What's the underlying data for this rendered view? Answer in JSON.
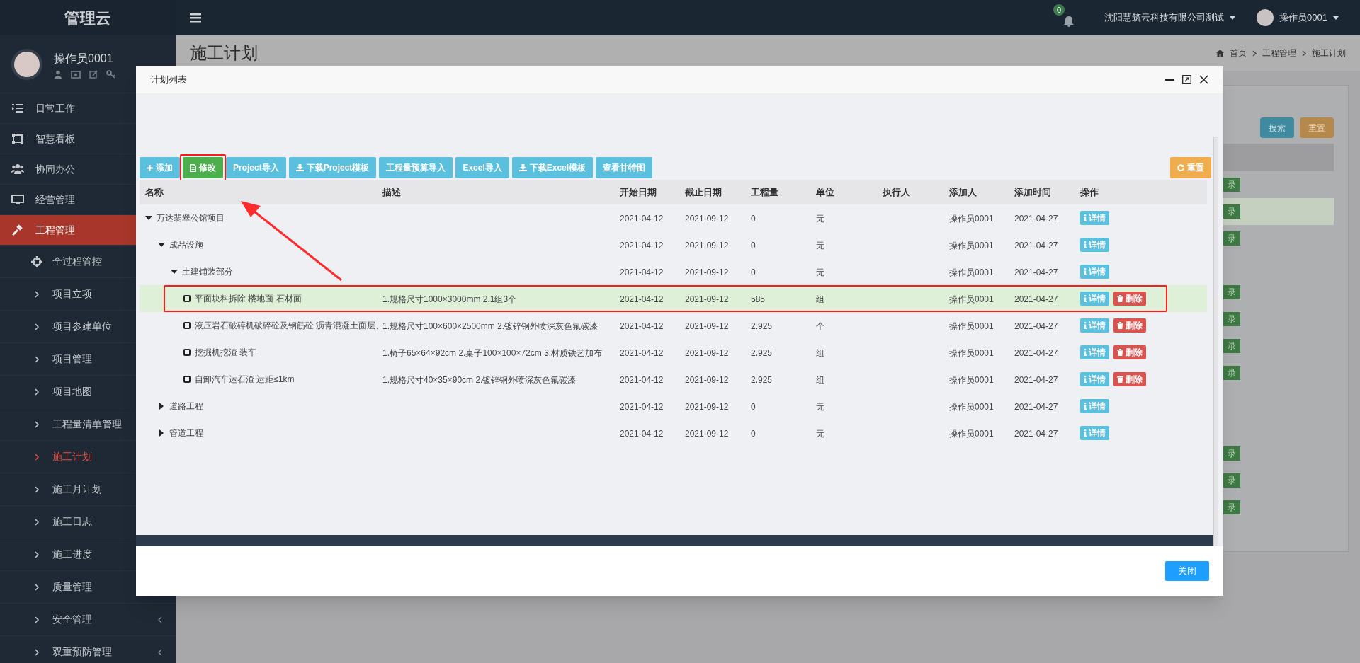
{
  "sidebar": {
    "brand": "管理云",
    "user": {
      "name": "操作员0001"
    },
    "items": [
      {
        "label": "日常工作",
        "selected": false
      },
      {
        "label": "智慧看板",
        "selected": false
      },
      {
        "label": "协同办公",
        "selected": false
      },
      {
        "label": "经营管理",
        "selected": false
      },
      {
        "label": "工程管理",
        "selected": true,
        "children": [
          {
            "label": "全过程管控",
            "kind": "icon",
            "selected": false
          },
          {
            "label": "项目立项",
            "kind": "arrow",
            "selected": false
          },
          {
            "label": "项目参建单位",
            "kind": "arrow",
            "selected": false
          },
          {
            "label": "项目管理",
            "kind": "arrow",
            "selected": false
          },
          {
            "label": "项目地图",
            "kind": "arrow",
            "selected": false
          },
          {
            "label": "工程量清单管理",
            "kind": "arrow",
            "selected": false
          },
          {
            "label": "施工计划",
            "kind": "arrow",
            "selected": true
          },
          {
            "label": "施工月计划",
            "kind": "arrow",
            "selected": false
          },
          {
            "label": "施工日志",
            "kind": "arrow",
            "selected": false
          },
          {
            "label": "施工进度",
            "kind": "arrow",
            "selected": false
          },
          {
            "label": "质量管理",
            "kind": "arrow",
            "selected": false
          },
          {
            "label": "安全管理",
            "kind": "arrow",
            "selected": false,
            "has_submenu": true
          },
          {
            "label": "双重预防管理",
            "kind": "arrow",
            "selected": false,
            "has_submenu": true
          }
        ]
      }
    ]
  },
  "header": {
    "notifications": "0",
    "company": "沈阳慧筑云科技有限公司测试",
    "user": "操作员0001"
  },
  "page": {
    "title": "施工计划",
    "breadcrumb": [
      "首页",
      "工程管理",
      "施工计划"
    ],
    "search_button": "搜索",
    "reset_button": "重置",
    "rows": [
      {
        "action": "录",
        "highlighted": false
      },
      {
        "action": "录",
        "highlighted": true
      },
      {
        "action": "录",
        "highlighted": false
      },
      {
        "highlighted": false
      },
      {
        "action": "录",
        "highlighted": false
      },
      {
        "action": "录",
        "highlighted": false
      },
      {
        "action": "录",
        "highlighted": false
      },
      {
        "action": "录",
        "highlighted": false
      },
      {
        "highlighted": false
      },
      {
        "highlighted": false
      },
      {
        "action": "录",
        "highlighted": false
      },
      {
        "action": "录",
        "highlighted": false
      },
      {
        "action": "录",
        "highlighted": false
      }
    ]
  },
  "modal": {
    "title": "计划列表",
    "toolbar": [
      {
        "label": "添加",
        "kind": "add"
      },
      {
        "label": "修改",
        "kind": "edit",
        "outlined": true
      },
      {
        "label": "Project导入",
        "kind": "plain"
      },
      {
        "label": "下载Project模板",
        "kind": "download"
      },
      {
        "label": "工程量预算导入",
        "kind": "plain"
      },
      {
        "label": "Excel导入",
        "kind": "plain"
      },
      {
        "label": "下载Excel模板",
        "kind": "download"
      },
      {
        "label": "查看甘特图",
        "kind": "plain"
      }
    ],
    "reset_button": "重置",
    "table": {
      "columns": [
        "名称",
        "描述",
        "开始日期",
        "截止日期",
        "工程量",
        "单位",
        "执行人",
        "添加人",
        "添加时间",
        "操作"
      ],
      "rows": [
        {
          "name": "万达翡翠公馆项目",
          "start": "2021-04-12",
          "end": "2021-09-12",
          "quantity": "0",
          "unit": "无",
          "creator": "操作员0001",
          "created": "2021-04-27",
          "actions": [
            {
              "label": "详情",
              "kind": "info"
            }
          ],
          "expanded": true,
          "selected": false,
          "outlined": false,
          "children": [
            {
              "name": "成品设施",
              "start": "2021-04-12",
              "end": "2021-09-12",
              "quantity": "0",
              "unit": "无",
              "creator": "操作员0001",
              "created": "2021-04-27",
              "actions": [
                {
                  "label": "详情",
                  "kind": "info"
                }
              ],
              "expanded": true,
              "selected": false,
              "outlined": false,
              "children": [
                {
                  "name": "土建铺装部分",
                  "start": "2021-04-12",
                  "end": "2021-09-12",
                  "quantity": "0",
                  "unit": "无",
                  "creator": "操作员0001",
                  "created": "2021-04-27",
                  "actions": [
                    {
                      "label": "详情",
                      "kind": "info"
                    }
                  ],
                  "expanded": true,
                  "selected": false,
                  "outlined": false,
                  "children": [
                    {
                      "name": "平面块料拆除 楼地面 石材面",
                      "description": "1.规格尺寸1000×3000mm  2.1组3个",
                      "start": "2021-04-12",
                      "end": "2021-09-12",
                      "quantity": "585",
                      "unit": "组",
                      "creator": "操作员0001",
                      "created": "2021-04-27",
                      "actions": [
                        {
                          "label": "详情",
                          "kind": "info"
                        },
                        {
                          "label": "删除",
                          "kind": "delete"
                        }
                      ],
                      "checked": false,
                      "selected": true,
                      "outlined": true
                    },
                    {
                      "name": "液压岩石破碎机破碎砼及钢筋砼 沥青混凝土面层、",
                      "description": "1.规格尺寸100×600×2500mm    2.镀锌钢外喷深灰色氟碳漆",
                      "start": "2021-04-12",
                      "end": "2021-09-12",
                      "quantity": "2.925",
                      "unit": "个",
                      "creator": "操作员0001",
                      "created": "2021-04-27",
                      "actions": [
                        {
                          "label": "详情",
                          "kind": "info"
                        },
                        {
                          "label": "删除",
                          "kind": "delete"
                        }
                      ],
                      "checked": false,
                      "selected": false,
                      "outlined": false
                    },
                    {
                      "name": "挖掘机挖渣 装车",
                      "description": "1.椅子65×64×92cm   2.桌子100×100×72cm     3.材质铁艺加布",
                      "start": "2021-04-12",
                      "end": "2021-09-12",
                      "quantity": "2.925",
                      "unit": "组",
                      "creator": "操作员0001",
                      "created": "2021-04-27",
                      "actions": [
                        {
                          "label": "详情",
                          "kind": "info"
                        },
                        {
                          "label": "删除",
                          "kind": "delete"
                        }
                      ],
                      "checked": false,
                      "selected": false,
                      "outlined": false
                    },
                    {
                      "name": "自卸汽车运石渣 运距≤1km",
                      "description": "1.规格尺寸40×35×90cm 2.镀锌钢外喷深灰色氟碳漆",
                      "start": "2021-04-12",
                      "end": "2021-09-12",
                      "quantity": "2.925",
                      "unit": "组",
                      "creator": "操作员0001",
                      "created": "2021-04-27",
                      "actions": [
                        {
                          "label": "详情",
                          "kind": "info"
                        },
                        {
                          "label": "删除",
                          "kind": "delete"
                        }
                      ],
                      "checked": false,
                      "selected": false,
                      "outlined": false
                    }
                  ]
                }
              ]
            },
            {
              "name": "道路工程",
              "start": "2021-04-12",
              "end": "2021-09-12",
              "quantity": "0",
              "unit": "无",
              "creator": "操作员0001",
              "created": "2021-04-27",
              "actions": [
                {
                  "label": "详情",
                  "kind": "info"
                }
              ],
              "expanded": false,
              "selected": false,
              "outlined": false
            },
            {
              "name": "管道工程",
              "start": "2021-04-12",
              "end": "2021-09-12",
              "quantity": "0",
              "unit": "无",
              "creator": "操作员0001",
              "created": "2021-04-27",
              "actions": [
                {
                  "label": "详情",
                  "kind": "info"
                }
              ],
              "expanded": false,
              "selected": false,
              "outlined": false
            }
          ]
        }
      ]
    },
    "close_button": "关闭"
  }
}
